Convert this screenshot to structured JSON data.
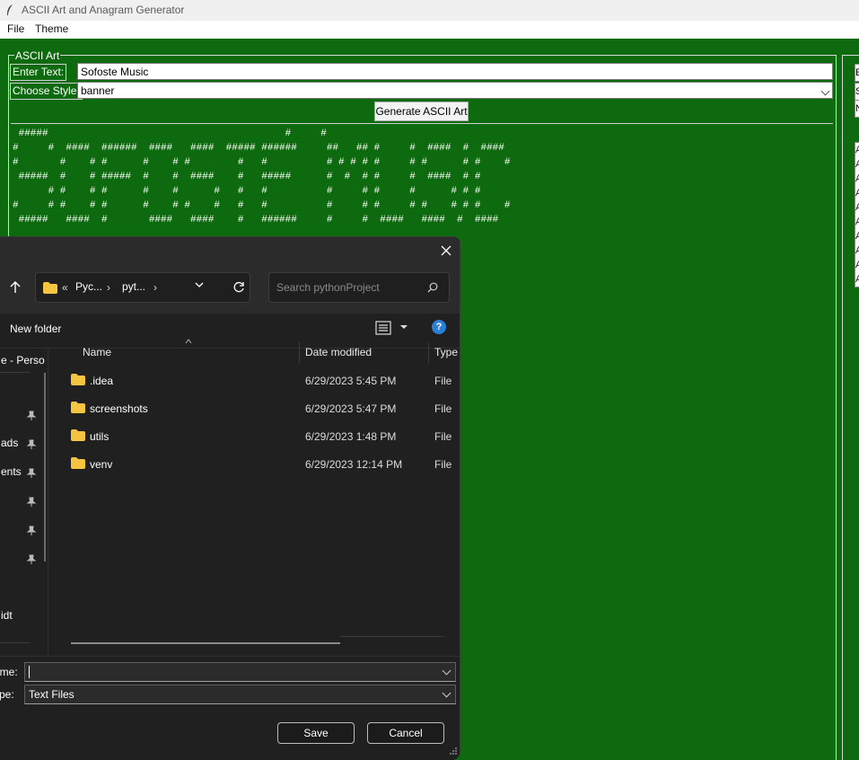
{
  "window": {
    "title": "ASCII Art and Anagram Generator"
  },
  "menu": {
    "file": "File",
    "theme": "Theme"
  },
  "ascii_panel": {
    "label": "ASCII Art",
    "enter_text_label": "Enter Text:",
    "enter_text_value": "Sofoste Music",
    "choose_style_label": "Choose Style:",
    "style_value": "banner",
    "generate_button": "Generate ASCII Art",
    "output": " #####                                        #     #\n#     #  ####  ######  ####   ####  ##### ######     ##   ## #     #  ####  #  ####\n#       #    # #      #    # #        #   #          # # # # #     # #      # #    #\n #####  #    # #####  #    #  ####    #   #####      #  #  # #     #  ####  # #\n      # #    # #      #    #      #   #   #          #     # #     #      # # #\n#     # #    # #      #    # #    #   #   #          #     # #     # #    # # #    #\n #####   ####  #       ####   ####    #   ######     #     #  ####   ####  #  ####"
  },
  "right_panel": {
    "cells": [
      "E",
      "S",
      "N"
    ],
    "list": [
      "A",
      "A",
      "A",
      "A",
      "A",
      "A",
      "A",
      "A",
      "A",
      "A"
    ]
  },
  "dialog": {
    "breadcrumb": [
      "«",
      "Pyc...",
      "pyt..."
    ],
    "search_placeholder": "Search pythonProject",
    "new_folder": "New folder",
    "help": "?",
    "nav_items": [
      "e - Perso",
      "ads",
      "ents",
      "idt"
    ],
    "columns": {
      "name": "Name",
      "date": "Date modified",
      "type": "Type"
    },
    "files": [
      {
        "name": ".idea",
        "date": "6/29/2023 5:45 PM",
        "type": "File folder"
      },
      {
        "name": "screenshots",
        "date": "6/29/2023 5:47 PM",
        "type": "File folder"
      },
      {
        "name": "utils",
        "date": "6/29/2023 1:48 PM",
        "type": "File folder"
      },
      {
        "name": "venv",
        "date": "6/29/2023 12:14 PM",
        "type": "File folder"
      }
    ],
    "filename_label": "ame:",
    "filename_value": "",
    "filetype_label": "ype:",
    "filetype_value": "Text Files",
    "save": "Save",
    "cancel": "Cancel"
  },
  "colors": {
    "app_bg": "#0e6a0e",
    "dialog_bg": "#202020",
    "folder": "#f5c542",
    "help": "#2c7fd8"
  }
}
